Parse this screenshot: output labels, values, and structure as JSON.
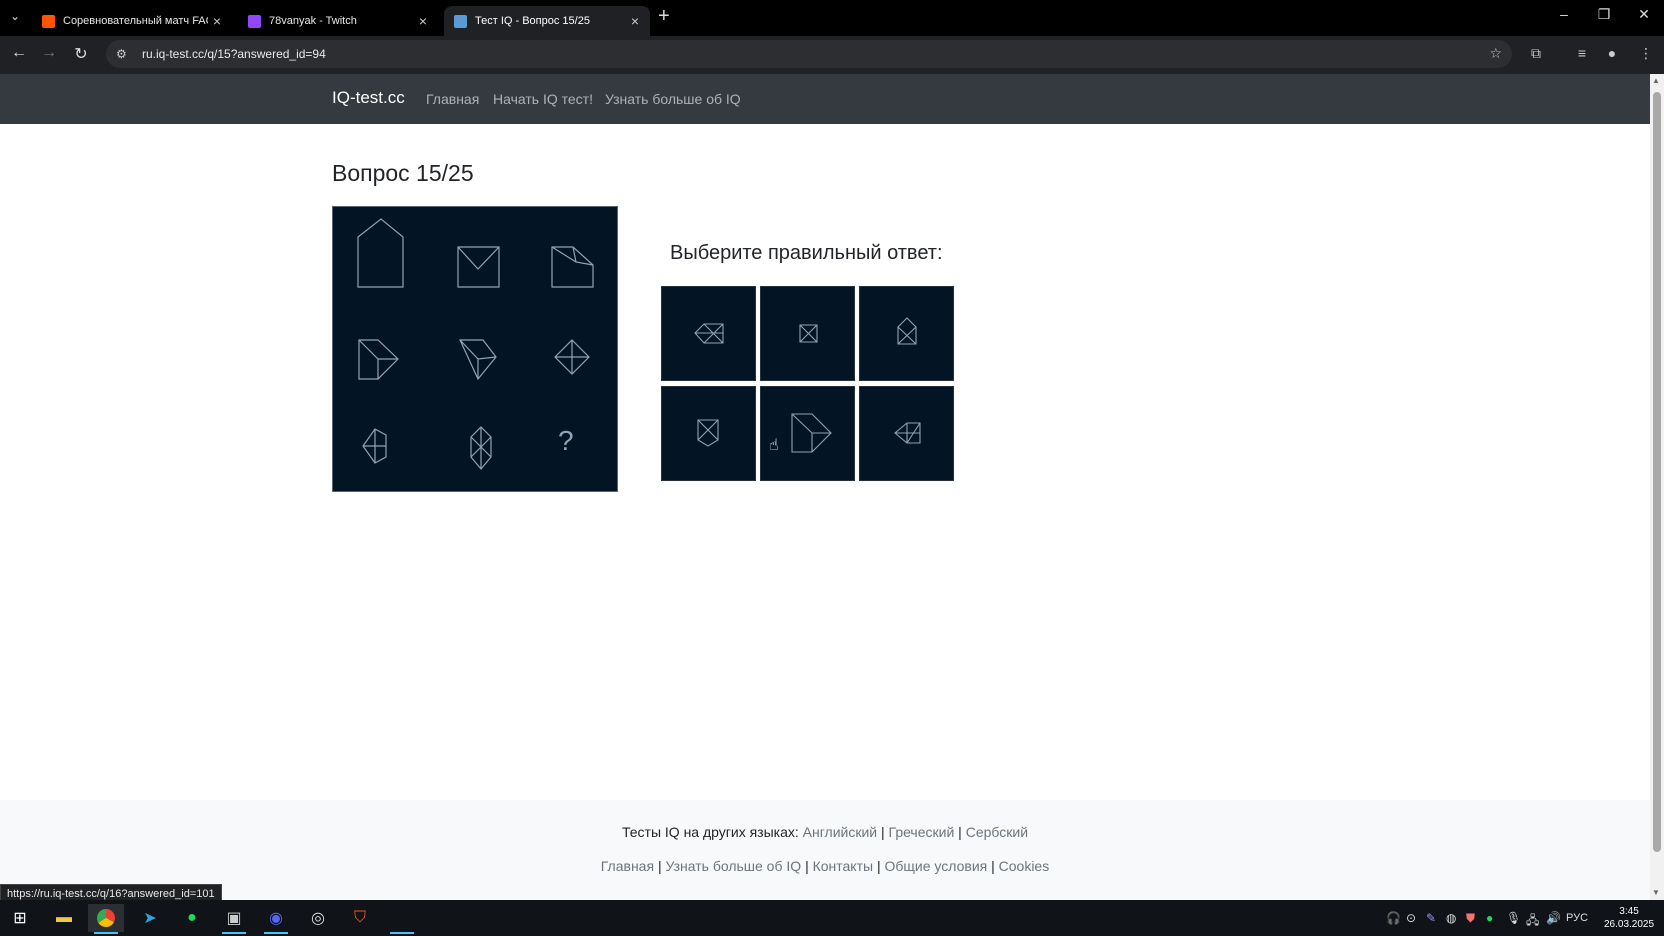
{
  "browser": {
    "tabs": [
      {
        "title": "Соревновательный матч FACEIT",
        "favicon_color": "#ff5500",
        "active": false
      },
      {
        "title": "78vanyak - Twitch",
        "favicon_color": "#9146ff",
        "active": false
      },
      {
        "title": "Тест IQ - Вопрос 15/25",
        "favicon_color": "#5b9bd5",
        "active": true
      }
    ],
    "url": "ru.iq-test.cc/q/15?answered_id=94",
    "status_url": "https://ru.iq-test.cc/q/16?answered_id=101"
  },
  "site": {
    "brand": "IQ-test.cc",
    "nav": [
      "Главная",
      "Начать IQ тест!",
      "Узнать больше об IQ"
    ]
  },
  "question": {
    "title": "Вопрос 15/25",
    "missing_mark": "?",
    "answer_prompt": "Выберите правильный ответ:",
    "option_count": 6
  },
  "footer": {
    "lang_prefix": "Тесты IQ на других языках:",
    "languages": [
      "Английский",
      "Греческий",
      "Сербский"
    ],
    "links": [
      "Главная",
      "Узнать больше об IQ",
      "Контакты",
      "Общие условия",
      "Cookies"
    ],
    "sep": "|"
  },
  "taskbar": {
    "lang": "РУС",
    "time": "3:45",
    "date": "26.03.2025"
  },
  "colors": {
    "puzzle_bg": "#031425",
    "puzzle_stroke": "#8fa3b8",
    "nav_bg": "#343a40"
  }
}
